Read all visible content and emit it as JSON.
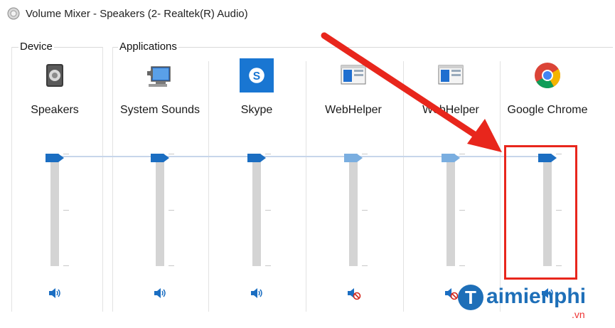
{
  "window": {
    "title": "Volume Mixer - Speakers (2- Realtek(R) Audio)"
  },
  "groups": {
    "device_label": "Device",
    "applications_label": "Applications"
  },
  "device": {
    "name": "Speakers",
    "icon": "speaker-icon",
    "volume": 1.0,
    "muted": false
  },
  "applications": [
    {
      "name": "System Sounds",
      "icon": "system-sounds-icon",
      "volume": 1.0,
      "muted": false
    },
    {
      "name": "Skype",
      "icon": "skype-icon",
      "volume": 1.0,
      "muted": false
    },
    {
      "name": "WebHelper",
      "icon": "webhelper-icon",
      "volume": 1.0,
      "muted": true
    },
    {
      "name": "WebHelper",
      "icon": "webhelper-icon",
      "volume": 1.0,
      "muted": true
    },
    {
      "name": "Google Chrome",
      "icon": "chrome-icon",
      "volume": 1.0,
      "muted": false
    }
  ],
  "colors": {
    "accent": "#1b6ec2",
    "muted_thumb": "#7aaee0",
    "annotation_red": "#e8261c"
  },
  "watermark": {
    "brand": "aimienphi",
    "domain": ".vn"
  }
}
